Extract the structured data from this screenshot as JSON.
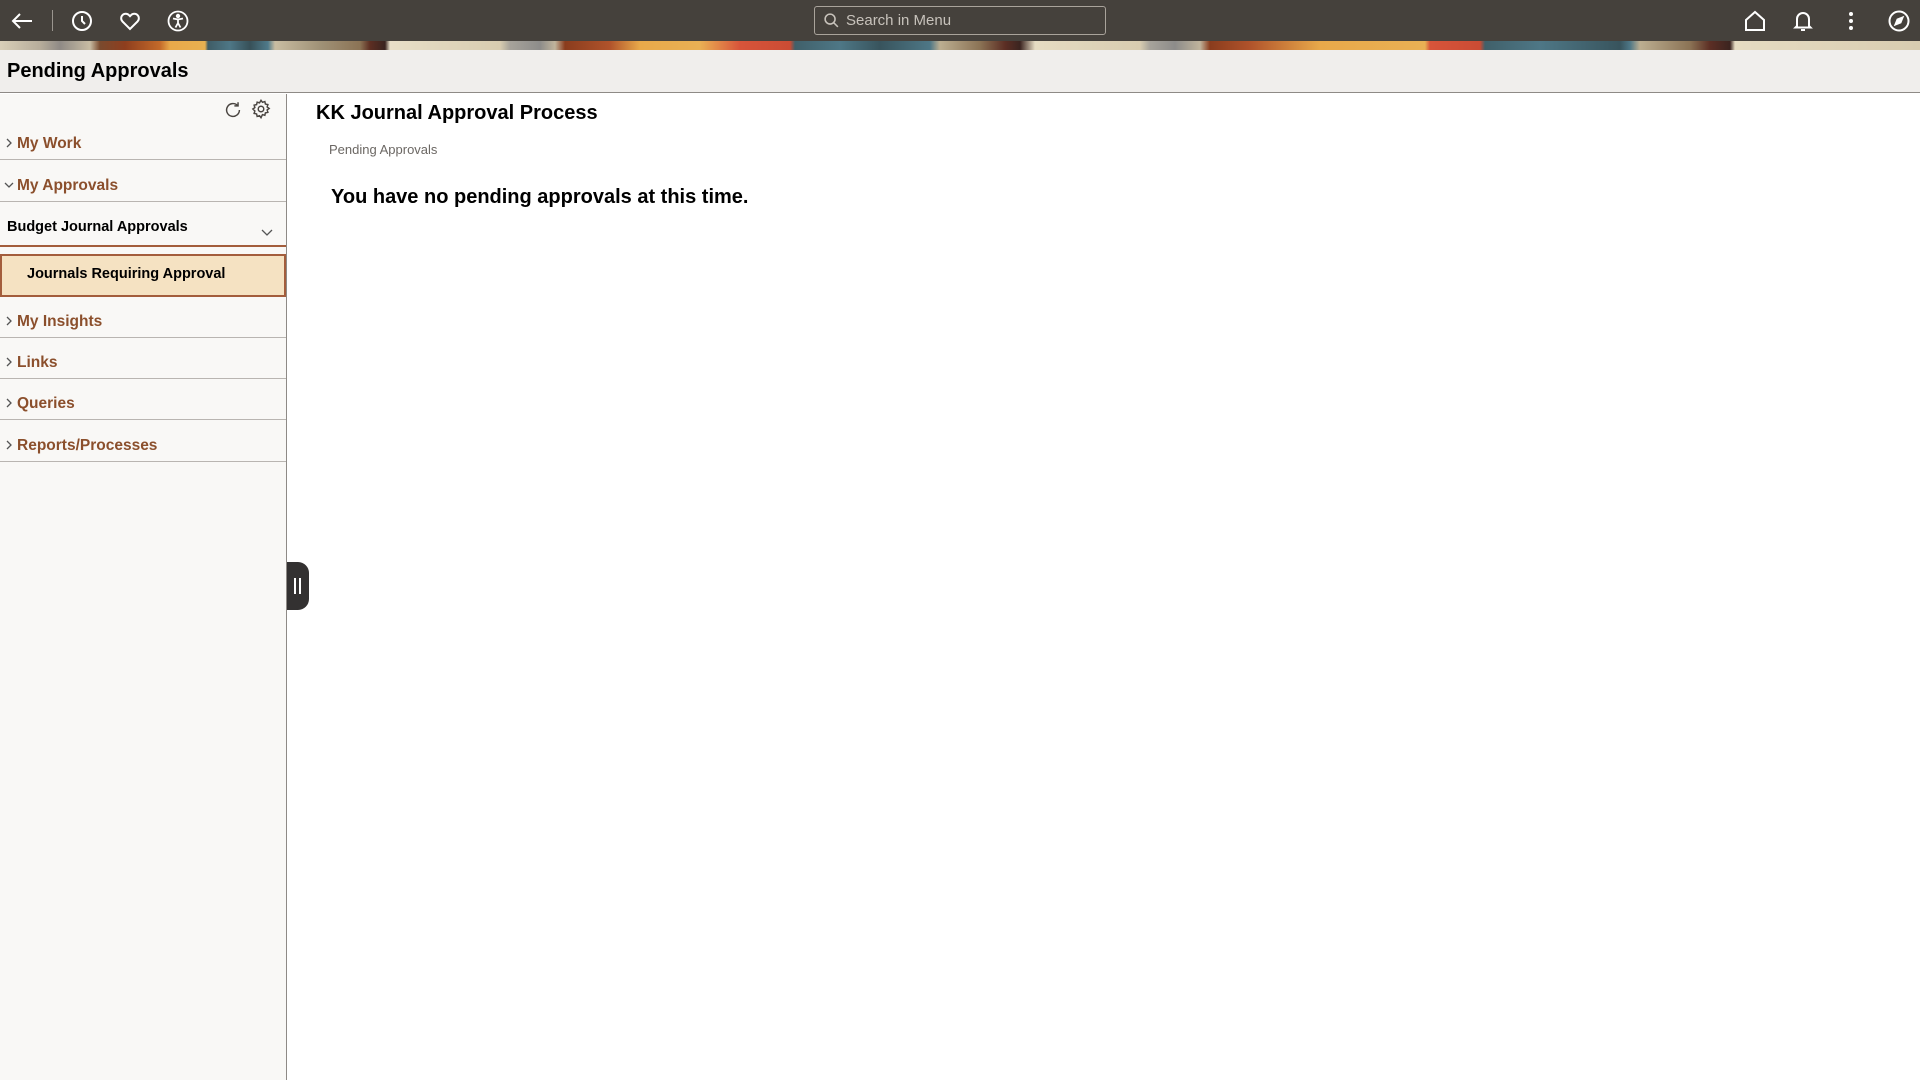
{
  "topbar": {
    "icons": {
      "back": "back-arrow-icon",
      "recent": "clock-icon",
      "favorites": "heart-icon",
      "accessibility": "accessibility-icon",
      "home": "home-icon",
      "notifications": "bell-icon",
      "actions": "kebab-menu-icon",
      "navigator": "compass-icon"
    },
    "search": {
      "placeholder": "Search in Menu",
      "value": ""
    }
  },
  "header": {
    "title": "Pending Approvals"
  },
  "sidebar": {
    "toolbar": {
      "refresh": "refresh-icon",
      "settings": "gear-icon"
    },
    "groups": [
      {
        "label": "My Work",
        "expanded": false
      },
      {
        "label": "My Approvals",
        "expanded": true,
        "children": [
          {
            "label": "Budget Journal Approvals",
            "expanded": true,
            "children": [
              {
                "label": "Journals Requiring Approval",
                "selected": true
              }
            ]
          }
        ]
      },
      {
        "label": "My Insights",
        "expanded": false
      },
      {
        "label": "Links",
        "expanded": false
      },
      {
        "label": "Queries",
        "expanded": false
      },
      {
        "label": "Reports/Processes",
        "expanded": false
      }
    ]
  },
  "main": {
    "title": "KK Journal Approval Process",
    "subtitle": "Pending Approvals",
    "message": "You have no pending approvals at this time."
  },
  "colors": {
    "topbar_bg": "#45413c",
    "nav_label": "#8b4f2c",
    "selected_bg": "#f5e2c2",
    "selected_border": "#a35d3c"
  }
}
